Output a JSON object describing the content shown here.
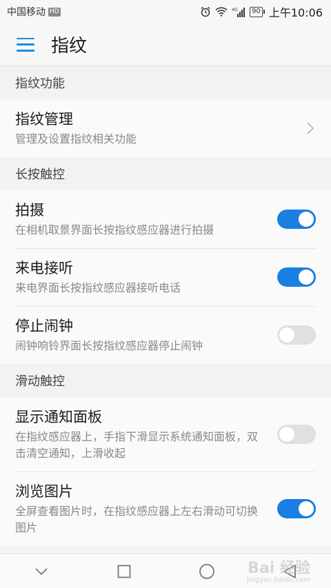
{
  "status_bar": {
    "carrier": "中国移动",
    "carrier_badge": "HD",
    "battery": "90",
    "time": "上午10:06"
  },
  "app_bar": {
    "title": "指纹"
  },
  "sections": [
    {
      "header": "指纹功能",
      "rows": [
        {
          "title": "指纹管理",
          "subtitle": "管理及设置指纹相关功能",
          "control": "chevron"
        }
      ]
    },
    {
      "header": "长按触控",
      "rows": [
        {
          "title": "拍摄",
          "subtitle": "在相机取景界面长按指纹感应器进行拍摄",
          "control": "toggle",
          "on": true
        },
        {
          "title": "来电接听",
          "subtitle": "来电界面长按指纹感应器接听电话",
          "control": "toggle",
          "on": true
        },
        {
          "title": "停止闹钟",
          "subtitle": "闹钟响铃界面长按指纹感应器停止闹钟",
          "control": "toggle",
          "on": false
        }
      ]
    },
    {
      "header": "滑动触控",
      "rows": [
        {
          "title": "显示通知面板",
          "subtitle": "在指纹感应器上，手指下滑显示系统通知面板，双击清空通知，上滑收起",
          "control": "toggle",
          "on": false
        },
        {
          "title": "浏览图片",
          "subtitle": "全屏查看图片时，在指纹感应器上左右滑动可切换图片",
          "control": "toggle",
          "on": true
        }
      ]
    }
  ],
  "colors": {
    "accent": "#1a7fe0",
    "toggle_off": "#e0e0e0"
  },
  "watermark": {
    "text": "Bai 经验",
    "sub": "jingyan.baidu.com"
  }
}
